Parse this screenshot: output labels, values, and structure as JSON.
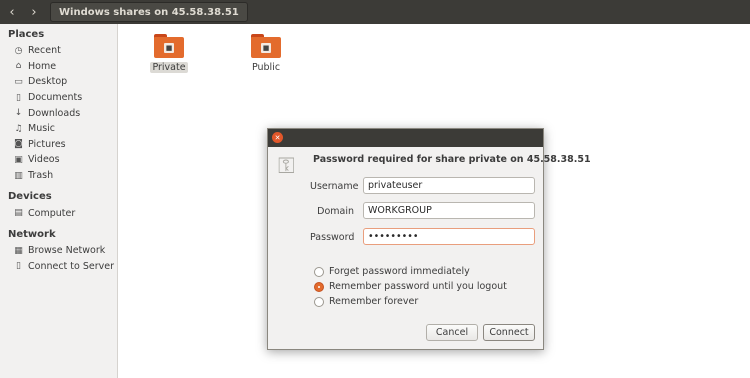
{
  "header": {
    "back_icon": "chevron-left-icon",
    "forward_icon": "chevron-right-icon",
    "path_label": "Windows shares on 45.58.38.51"
  },
  "sidebar": {
    "sections": [
      {
        "title": "Places",
        "items": [
          {
            "label": "Recent",
            "icon": "clock-icon"
          },
          {
            "label": "Home",
            "icon": "home-icon"
          },
          {
            "label": "Desktop",
            "icon": "folder-icon"
          },
          {
            "label": "Documents",
            "icon": "document-icon"
          },
          {
            "label": "Downloads",
            "icon": "download-icon"
          },
          {
            "label": "Music",
            "icon": "music-icon"
          },
          {
            "label": "Pictures",
            "icon": "camera-icon"
          },
          {
            "label": "Videos",
            "icon": "film-icon"
          },
          {
            "label": "Trash",
            "icon": "trash-icon"
          }
        ]
      },
      {
        "title": "Devices",
        "items": [
          {
            "label": "Computer",
            "icon": "drive-icon"
          }
        ]
      },
      {
        "title": "Network",
        "items": [
          {
            "label": "Browse Network",
            "icon": "network-icon"
          },
          {
            "label": "Connect to Server",
            "icon": "server-icon"
          }
        ]
      }
    ]
  },
  "content": {
    "folders": [
      {
        "label": "Private",
        "selected": true
      },
      {
        "label": "Public",
        "selected": false
      }
    ]
  },
  "dialog": {
    "heading": "Password required for share private on 45.58.38.51",
    "username_label": "Username",
    "username_value": "privateuser",
    "domain_label": "Domain",
    "domain_value": "WORKGROUP",
    "password_label": "Password",
    "password_value": "•••••••••",
    "radio_options": [
      {
        "label": "Forget password immediately",
        "selected": false
      },
      {
        "label": "Remember password until you logout",
        "selected": true
      },
      {
        "label": "Remember forever",
        "selected": false
      }
    ],
    "cancel_label": "Cancel",
    "connect_label": "Connect"
  },
  "colors": {
    "accent": "#e36b2d",
    "titlebar": "#3c3b37"
  }
}
